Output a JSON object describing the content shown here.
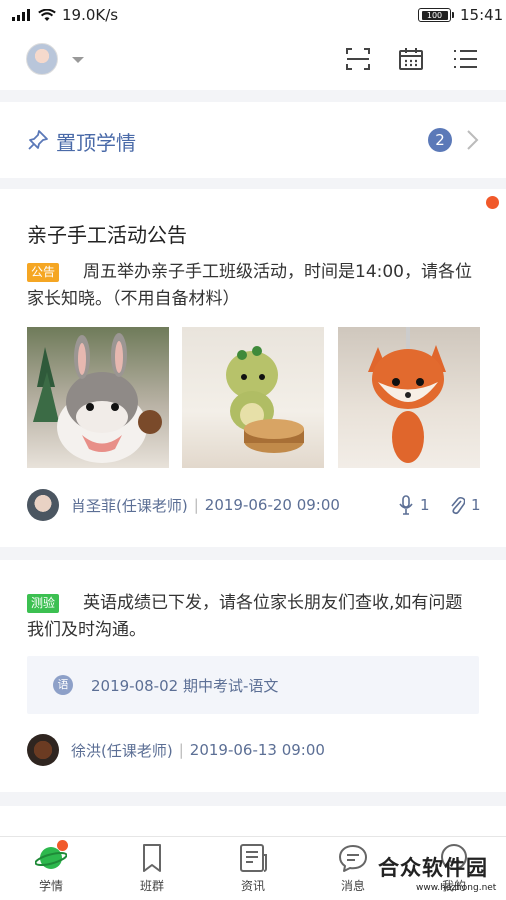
{
  "status_bar": {
    "network_speed": "19.0K/s",
    "battery": "100",
    "time": "15:41"
  },
  "header": {
    "avatar_icon": "user-avatar",
    "dropdown_icon": "caret-down-icon",
    "actions": [
      "scan-icon",
      "calendar-icon",
      "list-icon"
    ]
  },
  "pinned": {
    "label": "置顶学情",
    "count": "2",
    "icon": "pin-icon"
  },
  "posts": [
    {
      "title": "亲子手工活动公告",
      "tag": "公告",
      "tag_color": "#f5a623",
      "body": "周五举办亲子手工班级活动，时间是14:00，请各位家长知晓。（不用自备材料）",
      "images": [
        "felt-bunny-photo",
        "felt-dinosaur-photo",
        "felt-fox-photo"
      ],
      "author": "肖圣菲(任课老师)",
      "date": "2019-06-20 09:00",
      "voice_count": "1",
      "attachment_count": "1",
      "unread": true
    },
    {
      "tag": "测验",
      "tag_color": "#3cc051",
      "body": "英语成绩已下发，请各位家长朋友们查收,如有问题我们及时沟通。",
      "exam_badge": "语",
      "exam": "2019-08-02 期中考试-语文",
      "author": "徐洪(任课老师)",
      "date": "2019-06-13 09:00"
    }
  ],
  "tabs": [
    {
      "label": "学情",
      "icon": "planet-icon",
      "active": true,
      "badge": true
    },
    {
      "label": "班群",
      "icon": "bookmark-icon"
    },
    {
      "label": "资讯",
      "icon": "news-icon"
    },
    {
      "label": "消息",
      "icon": "chat-icon"
    },
    {
      "label": "我的",
      "icon": "profile-icon"
    }
  ],
  "watermark": {
    "text": "合众软件园",
    "url": "www.hezhong.net"
  },
  "colors": {
    "accent_blue": "#5b79b8",
    "notice_orange": "#f5a623",
    "quiz_green": "#3cc051",
    "unread_red": "#f1592a",
    "active_tab_green": "#2db84d"
  }
}
